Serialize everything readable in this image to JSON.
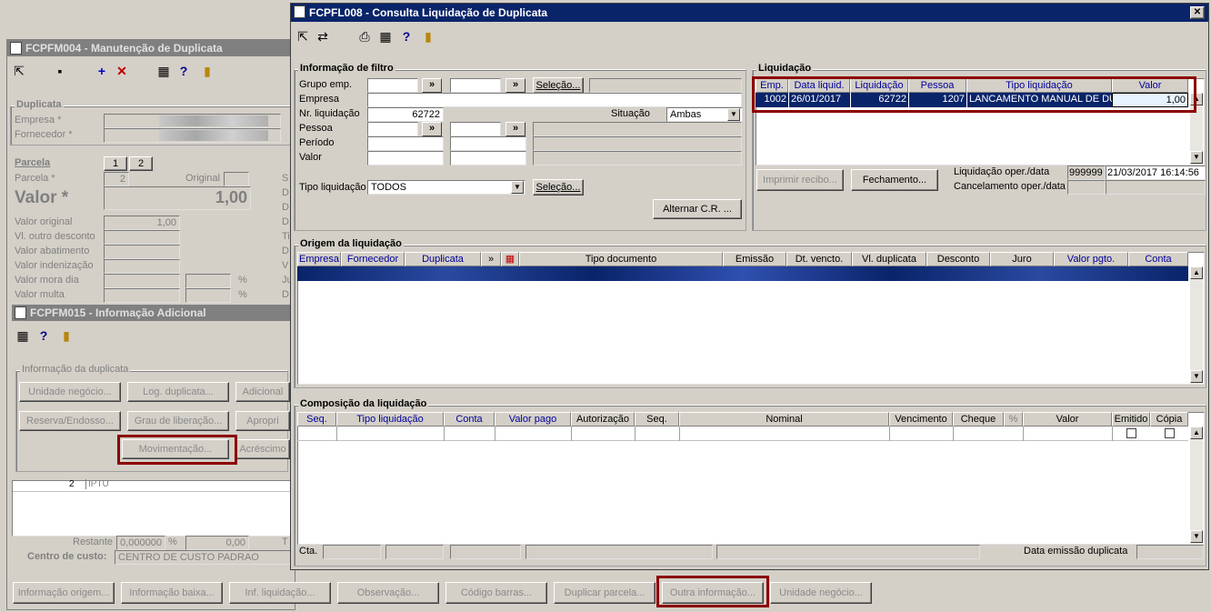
{
  "win_fm004": {
    "title": "FCPFM004 - Manutenção de Duplicata",
    "group_duplicata": "Duplicata",
    "empresa_label": "Empresa *",
    "fornecedor_label": "Fornecedor *",
    "parcela_group": "Parcela",
    "parcela_tabs": [
      "1",
      "2"
    ],
    "parcela_label": "Parcela *",
    "parcela_value": "2",
    "original_label": "Original",
    "valor_label": "Valor *",
    "valor_value": "1,00",
    "valor_original_label": "Valor original",
    "valor_original_value": "1,00",
    "outro_desc_label": "Vl. outro desconto",
    "abatimento_label": "Valor abatimento",
    "indenizacao_label": "Valor indenização",
    "mora_label": "Valor mora dia",
    "multa_label": "Valor multa",
    "pct": "%",
    "right_letters": [
      "S",
      "D",
      "D",
      "D",
      "Ti",
      "D",
      "V",
      "Ju",
      "D"
    ],
    "row_value": "2",
    "row_text": "IPTU",
    "restante_label": "Restante",
    "restante_value": "0,000000",
    "restante_pct": "%",
    "restante_value2": "0,00",
    "t_letter": "T",
    "centro_label": "Centro de custo:",
    "centro_value": "CENTRO DE CUSTO PADRAO"
  },
  "win_fm015": {
    "title": "FCPFM015 - Informação Adicional",
    "group": "Informação da duplicata",
    "buttons": [
      "Unidade negócio...",
      "Log. duplicata...",
      "Adicional",
      "Reserva/Endosso...",
      "Grau de liberação...",
      "Apropri",
      "Movimentação...",
      "Acréscimo"
    ]
  },
  "bottom_buttons": [
    "Informação origem...",
    "Informação baixa...",
    "Inf. liquidação...",
    "Observação...",
    "Código barras...",
    "Duplicar parcela...",
    "Outra informação...",
    "Unidade negócio..."
  ],
  "win_fl008": {
    "title": "FCPFL008 - Consulta Liquidação de Duplicata",
    "close": "✕",
    "filtro": {
      "group": "Informação de filtro",
      "grupo_emp": "Grupo emp.",
      "empresa": "Empresa",
      "nr_liq": "Nr. liquidação",
      "nr_liq_value": "62722",
      "situacao": "Situação",
      "situacao_value": "Ambas",
      "pessoa": "Pessoa",
      "periodo": "Período",
      "valor": "Valor",
      "tipo_liq": "Tipo liquidação",
      "tipo_liq_value": "TODOS",
      "selecao": "Seleção...",
      "alternar": "Alternar C.R. ...",
      "chev": "»"
    },
    "liquidacao": {
      "group": "Liquidação",
      "headers": [
        "Emp.",
        "Data liquid.",
        "Liquidação",
        "Pessoa",
        "Tipo liquidação",
        "Valor"
      ],
      "row": [
        "1002",
        "26/01/2017",
        "62722",
        "1207",
        "LANCAMENTO MANUAL DE DUP",
        "1,00"
      ],
      "imprimir": "Imprimir recibo...",
      "fechamento": "Fechamento...",
      "oper_label": "Liquidação oper./data",
      "oper_user": "999999",
      "oper_date": "21/03/2017 16:14:56",
      "cancel_label": "Cancelamento oper./data"
    },
    "origem": {
      "group": "Origem da liquidação",
      "headers": [
        "Empresa",
        "Fornecedor",
        "Duplicata",
        "»",
        "Tipo documento",
        "Emissão",
        "Dt. vencto.",
        "Vl. duplicata",
        "Desconto",
        "Juro",
        "Valor pgto.",
        "Conta"
      ]
    },
    "composicao": {
      "group": "Composição da liquidação",
      "headers": [
        "Seq.",
        "Tipo liquidação",
        "Conta",
        "Valor pago",
        "Autorização",
        "Seq.",
        "Nominal",
        "Vencimento",
        "Cheque",
        "%",
        "Valor",
        "Emitido",
        "Cópia"
      ],
      "cta": "Cta.",
      "data_emissao": "Data emissão duplicata"
    }
  },
  "colors": {
    "title_active": "#0a246a",
    "title_inactive": "#808080",
    "highlight": "#8b0000",
    "selection": "#0a246a",
    "face": "#d4d0c8"
  }
}
